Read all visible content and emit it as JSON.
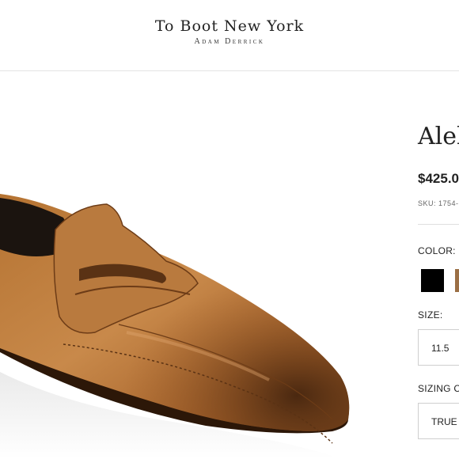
{
  "header": {
    "brand_name": "To Boot New York",
    "brand_sub": "Adam Derrick"
  },
  "product": {
    "title": "Alek",
    "price": "$425.0",
    "sku": "SKU: 1754-"
  },
  "options": {
    "color_label": "COLOR:",
    "colors": [
      {
        "name": "black",
        "hex": "#000000"
      },
      {
        "name": "cognac",
        "hex": "#9b6f45"
      }
    ],
    "size_label": "SIZE:",
    "size_value": "11.5",
    "sizing_label": "SIZING C",
    "sizing_value": "TRUE"
  },
  "image": {
    "subject": "brown-leather-penny-loafer",
    "leather_color": "#a8652b"
  }
}
